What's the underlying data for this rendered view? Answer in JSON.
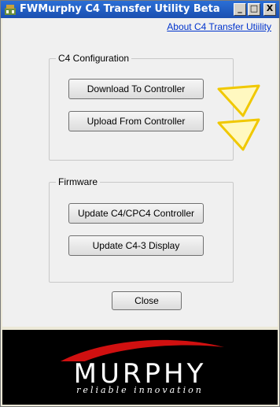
{
  "window": {
    "title": "FWMurphy C4 Transfer Utility Beta",
    "controls": {
      "minimize": "_",
      "maximize": "□",
      "close": "X"
    }
  },
  "links": {
    "about": "About C4 Transfer Utiility"
  },
  "config_group": {
    "legend": "C4 Configuration",
    "download_label": "Download To Controller",
    "upload_label": "Upload From Controller"
  },
  "firmware_group": {
    "legend": "Firmware",
    "update_controller_label": "Update C4/CPC4 Controller",
    "update_display_label": "Update C4-3 Display"
  },
  "close_label": "Close",
  "logo": {
    "name": "MURPHY",
    "tagline": "reliable innovation"
  },
  "colors": {
    "titlebar": "#1b4fb0",
    "arrow_fill": "#fff8c0",
    "arrow_stroke": "#f0c800",
    "logo_swoosh": "#d01010"
  }
}
